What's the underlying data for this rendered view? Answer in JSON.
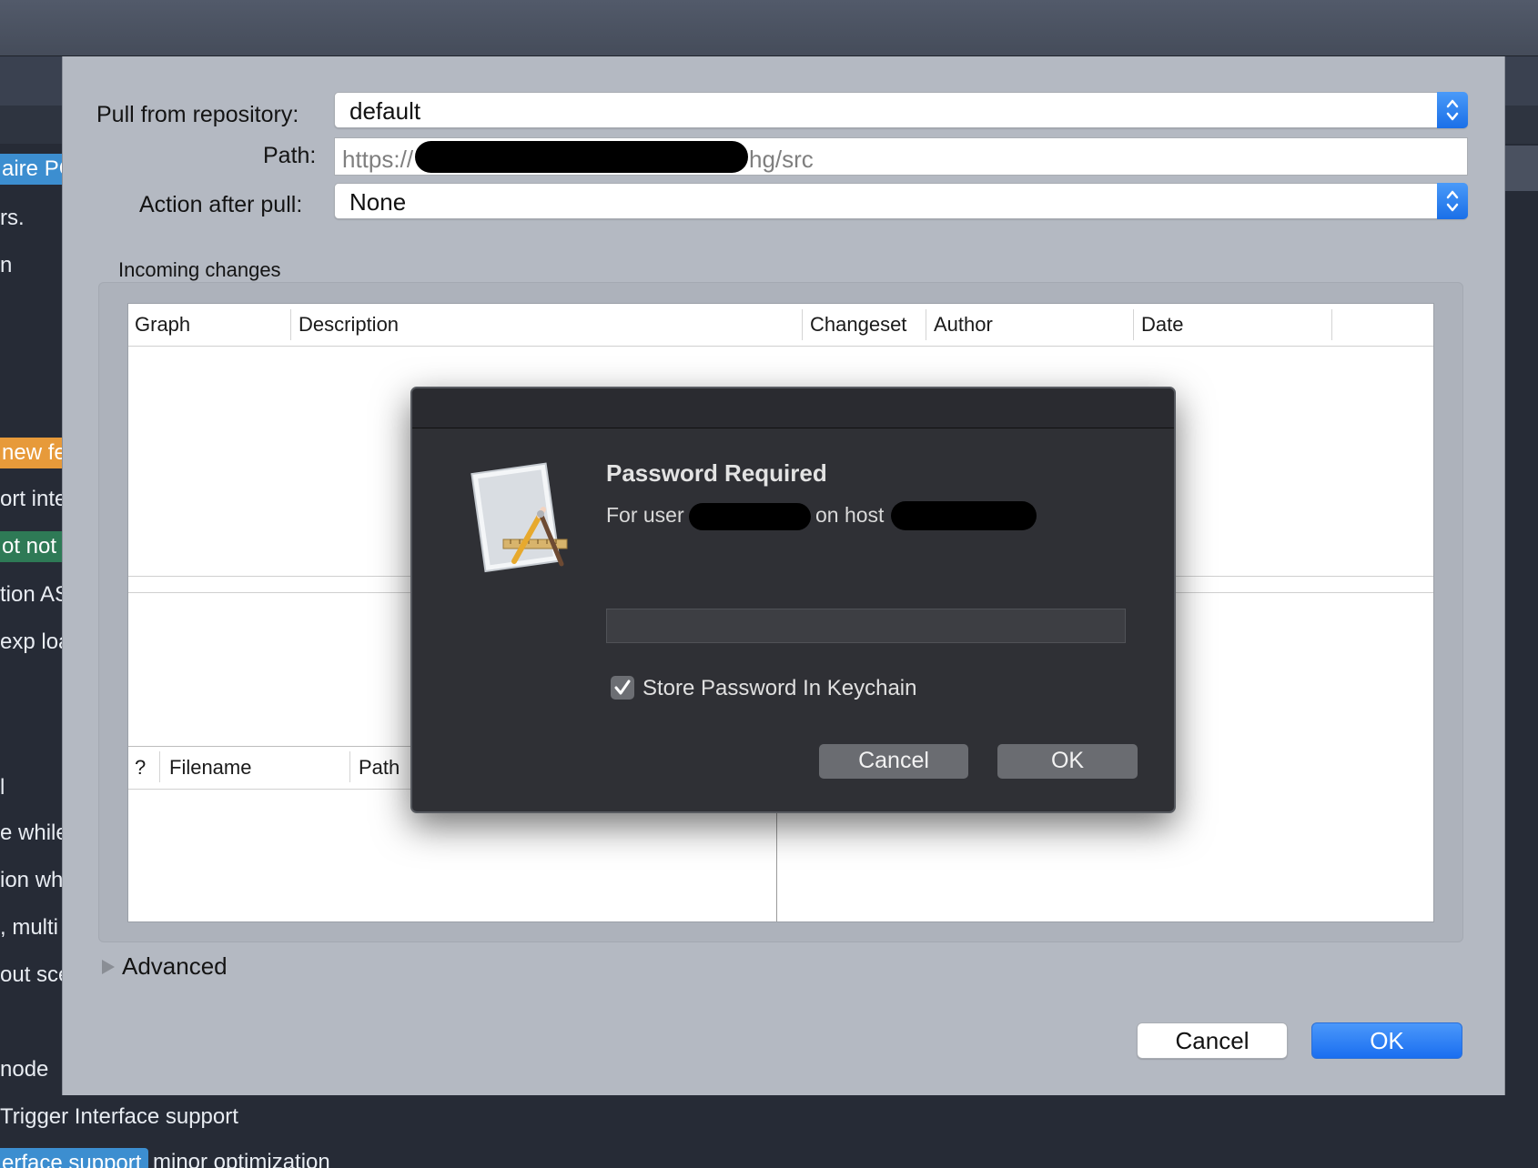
{
  "background": {
    "lines": [
      "aire PC",
      "rs.",
      "n",
      "new fea",
      "ort inte",
      "ot not v",
      "tion AS",
      "exp loa",
      "l",
      "e while",
      "ion wh",
      ", multi",
      "out sce",
      "node",
      "Trigger Interface support",
      "minor optimization"
    ],
    "tag_last": "erface support"
  },
  "pull": {
    "repo_label": "Pull from repository:",
    "repo_value": "default",
    "path_label": "Path:",
    "path_prefix": "https://",
    "path_suffix": "hg/src",
    "action_label": "Action after pull:",
    "action_value": "None",
    "incoming_label": "Incoming changes",
    "columns": [
      "Graph",
      "Description",
      "Changeset",
      "Author",
      "Date"
    ],
    "file_columns": [
      "?",
      "Filename",
      "Path"
    ],
    "advanced_label": "Advanced",
    "cancel_label": "Cancel",
    "ok_label": "OK"
  },
  "password_dialog": {
    "title": "Password Required",
    "for_user": "For user",
    "on_host": "on host",
    "store_label": "Store Password In Keychain",
    "store_checked": true,
    "cancel_label": "Cancel",
    "ok_label": "OK"
  },
  "colors": {
    "accent": "#1a6ef0",
    "tag_orange": "#e79a3a",
    "tag_green": "#2e7a56",
    "tag_blue": "#3c8ed0"
  }
}
